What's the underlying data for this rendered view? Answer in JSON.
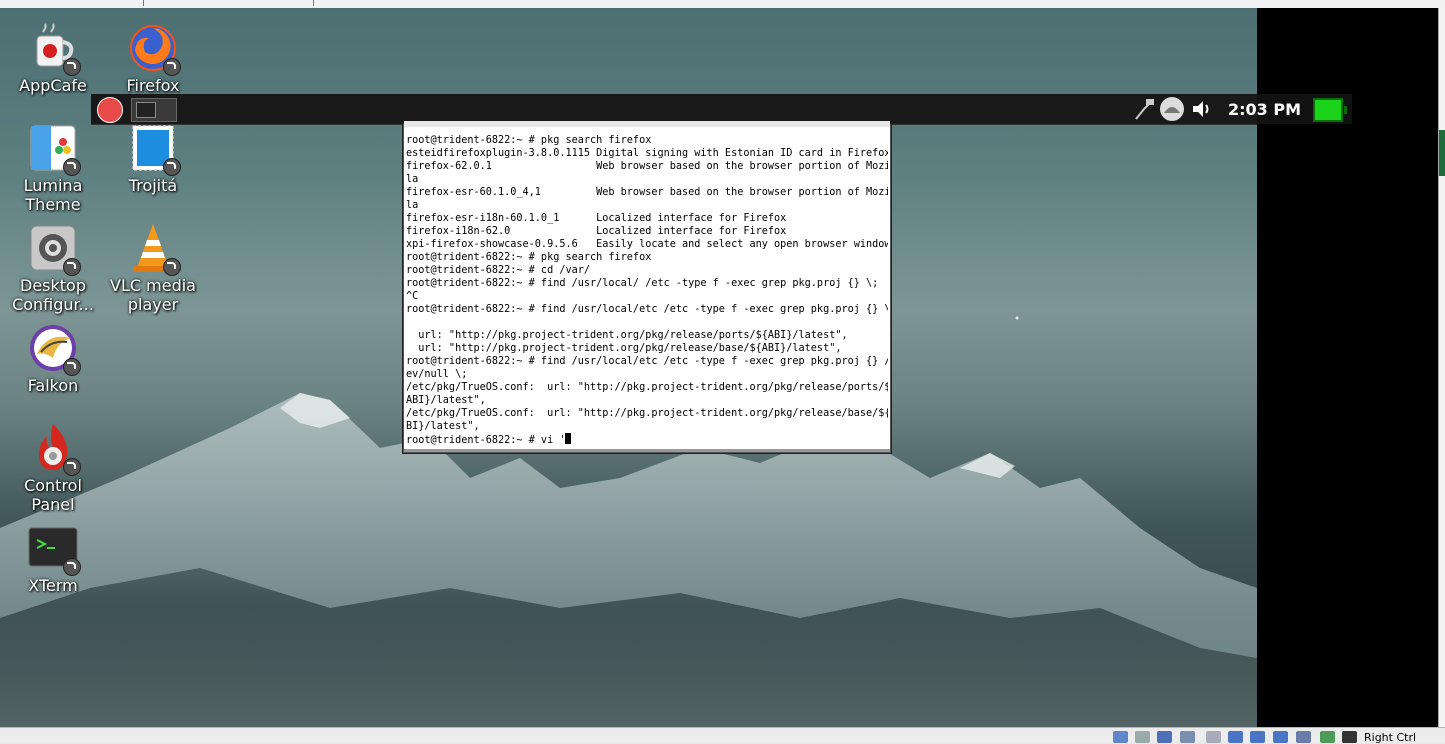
{
  "desktop_icons": [
    {
      "label": "AppCafe"
    },
    {
      "label": "Firefox Web Bro..."
    },
    {
      "label": "Lumina Theme"
    },
    {
      "label": "Trojitá"
    },
    {
      "label": "Desktop Configur..."
    },
    {
      "label": "VLC media player"
    },
    {
      "label": "Falkon"
    },
    {
      "label": "Control Panel"
    },
    {
      "label": "XTerm"
    }
  ],
  "panel": {
    "clock": "2:03 PM",
    "battery_color": "#19d219"
  },
  "terminal": {
    "lines": [
      "root@trident-6822:~ # pkg search firefox",
      "esteidfirefoxplugin-3.8.0.1115 Digital signing with Estonian ID card in Firefox",
      "firefox-62.0.1                 Web browser based on the browser portion of Mozil",
      "la",
      "firefox-esr-60.1.0_4,1         Web browser based on the browser portion of Mozil",
      "la",
      "firefox-esr-i18n-60.1.0_1      Localized interface for Firefox",
      "firefox-i18n-62.0              Localized interface for Firefox",
      "xpi-firefox-showcase-0.9.5.6   Easily locate and select any open browser window",
      "root@trident-6822:~ # pkg search firefox",
      "root@trident-6822:~ # cd /var/",
      "root@trident-6822:~ # find /usr/local/ /etc -type f -exec grep pkg.proj {} \\;",
      "^C",
      "root@trident-6822:~ # find /usr/local/etc /etc -type f -exec grep pkg.proj {} \\;",
      "",
      "  url: \"http://pkg.project-trident.org/pkg/release/ports/${ABI}/latest\",",
      "  url: \"http://pkg.project-trident.org/pkg/release/base/${ABI}/latest\",",
      "root@trident-6822:~ # find /usr/local/etc /etc -type f -exec grep pkg.proj {} /d",
      "ev/null \\;",
      "/etc/pkg/TrueOS.conf:  url: \"http://pkg.project-trident.org/pkg/release/ports/${",
      "ABI}/latest\",",
      "/etc/pkg/TrueOS.conf:  url: \"http://pkg.project-trident.org/pkg/release/base/${A",
      "BI}/latest\","
    ],
    "prompt_line": "root@trident-6822:~ # vi '"
  },
  "host_status": {
    "right_ctrl": "Right Ctrl"
  }
}
